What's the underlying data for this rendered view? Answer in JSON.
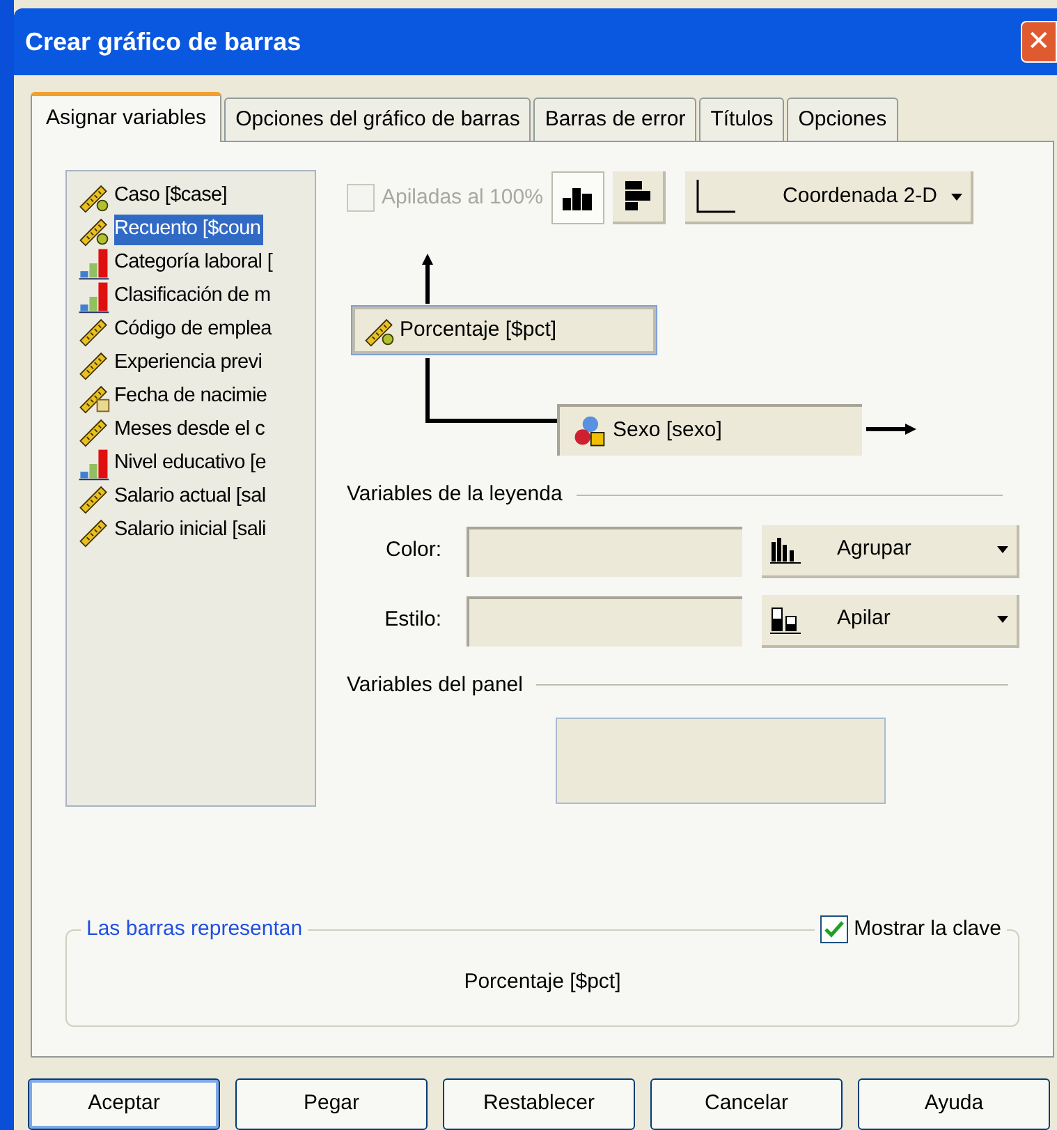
{
  "window": {
    "title": "Crear gráfico de barras",
    "close": "✕"
  },
  "tabs": [
    {
      "label": "Asignar variables",
      "selected": true
    },
    {
      "label": "Opciones del gráfico de barras",
      "selected": false
    },
    {
      "label": "Barras de error",
      "selected": false
    },
    {
      "label": "Títulos",
      "selected": false
    },
    {
      "label": "Opciones",
      "selected": false
    }
  ],
  "variables": [
    {
      "label": "Caso [$case]",
      "kind": "derived",
      "selected": false
    },
    {
      "label": "Recuento [$coun",
      "kind": "derived",
      "selected": true
    },
    {
      "label": "Categoría laboral [",
      "kind": "ordinal",
      "selected": false
    },
    {
      "label": "Clasificación de m",
      "kind": "ordinal",
      "selected": false
    },
    {
      "label": "Código de emplea",
      "kind": "scale",
      "selected": false
    },
    {
      "label": "Experiencia previ",
      "kind": "scale",
      "selected": false
    },
    {
      "label": "Fecha de nacimie",
      "kind": "date",
      "selected": false
    },
    {
      "label": "Meses desde el c",
      "kind": "scale",
      "selected": false
    },
    {
      "label": "Nivel educativo [e",
      "kind": "ordinal",
      "selected": false
    },
    {
      "label": "Salario actual [sal",
      "kind": "scale",
      "selected": false
    },
    {
      "label": "Salario inicial [sali",
      "kind": "scale",
      "selected": false
    }
  ],
  "toolbar": {
    "stacked_100": {
      "label": "Apiladas al 100%",
      "checked": false,
      "disabled": true
    },
    "orientation": [
      {
        "kind": "vertical",
        "selected": true
      },
      {
        "kind": "horizontal",
        "selected": false
      }
    ],
    "coordinates": "Coordenada 2-D"
  },
  "y_axis": {
    "label": "Porcentaje [$pct]",
    "kind": "derived"
  },
  "x_axis": {
    "label": "Sexo [sexo]",
    "kind": "nominal"
  },
  "legend_variables": {
    "title": "Variables de la leyenda",
    "rows": [
      {
        "label": "Color:",
        "mode": "Agrupar",
        "kind": "cluster"
      },
      {
        "label": "Estilo:",
        "mode": "Apilar",
        "kind": "stack"
      }
    ]
  },
  "panel_variables": {
    "title": "Variables del panel"
  },
  "bars_represent": {
    "title": "Las barras representan",
    "value": "Porcentaje [$pct]",
    "show_key": {
      "label": "Mostrar la clave",
      "checked": true
    }
  },
  "buttons": [
    "Aceptar",
    "Pegar",
    "Restablecer",
    "Cancelar",
    "Ayuda"
  ]
}
